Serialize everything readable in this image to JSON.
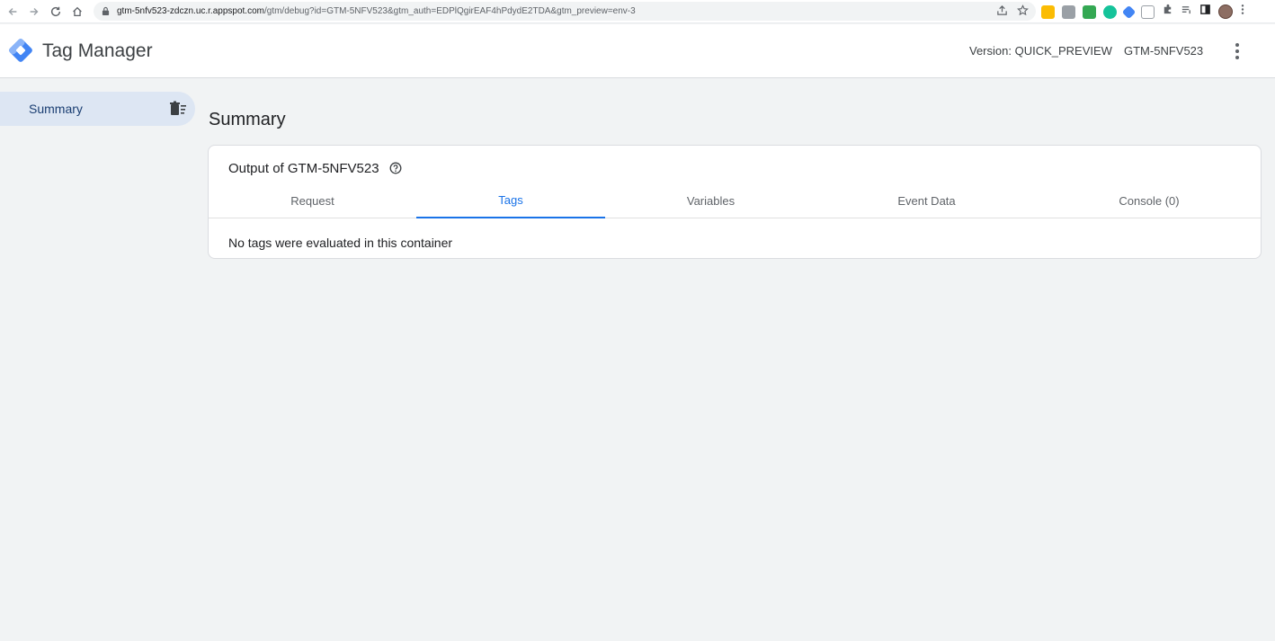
{
  "browser": {
    "url_host": "gtm-5nfv523-zdczn.uc.r.appspot.com",
    "url_path": "/gtm/debug?id=GTM-5NFV523&gtm_auth=EDPlQgirEAF4hPdydE2TDA&gtm_preview=env-3"
  },
  "header": {
    "app_title": "Tag Manager",
    "version_label": "Version: QUICK_PREVIEW",
    "container_id": "GTM-5NFV523"
  },
  "sidebar": {
    "items": [
      {
        "label": "Summary",
        "active": true
      }
    ]
  },
  "main": {
    "page_title": "Summary",
    "card": {
      "title": "Output of GTM-5NFV523",
      "tabs": [
        {
          "label": "Request",
          "active": false
        },
        {
          "label": "Tags",
          "active": true
        },
        {
          "label": "Variables",
          "active": false
        },
        {
          "label": "Event Data",
          "active": false
        },
        {
          "label": "Console (0)",
          "active": false
        }
      ],
      "body_text": "No tags were evaluated in this container"
    }
  },
  "colors": {
    "accent": "#1a73e8",
    "sidebar_active_bg": "#dde6f3",
    "page_bg": "#f1f3f4"
  }
}
